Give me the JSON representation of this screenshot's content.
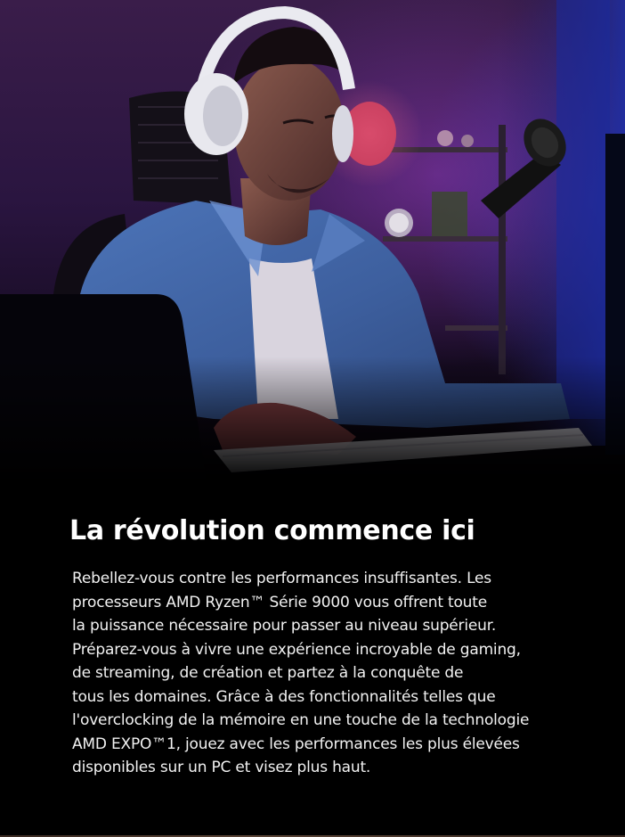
{
  "hero": {
    "image": "gamer-with-headset-photo"
  },
  "headline": "La révolution commence ici",
  "body": {
    "lines": [
      "Rebellez-vous contre les performances insuffisantes. Les",
      "processeurs AMD Ryzen™ Série 9000 vous offrent toute",
      "la puissance nécessaire pour passer au niveau supérieur.",
      "Préparez-vous à vivre une expérience incroyable de gaming,",
      "de streaming, de création et partez à la conquête de",
      "tous les domaines. Grâce à des fonctionnalités telles que",
      "l'overclocking de la mémoire en une touche de la technologie",
      "AMD EXPO™1, jouez avec les performances les plus élevées",
      "disponibles sur un PC et visez plus haut."
    ]
  },
  "colors": {
    "background": "#000000",
    "text": "#ffffff"
  }
}
